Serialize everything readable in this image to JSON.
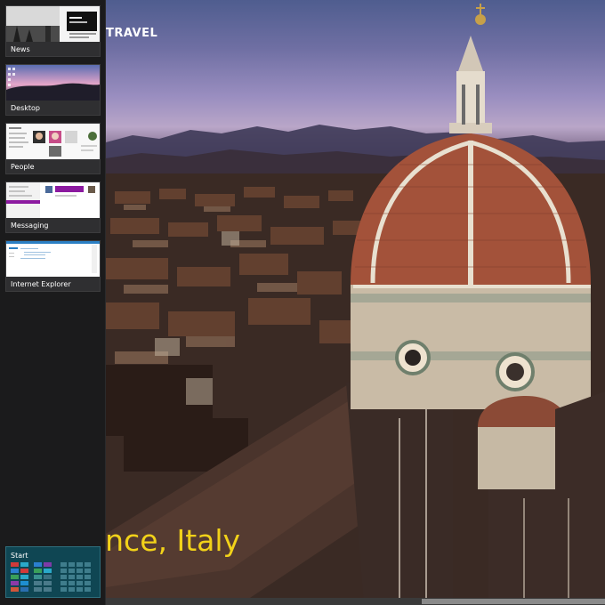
{
  "app": {
    "title": "TRAVEL",
    "location": "rence, Italy"
  },
  "switcher": {
    "tiles": [
      {
        "label": "News"
      },
      {
        "label": "Desktop"
      },
      {
        "label": "People"
      },
      {
        "label": "Messaging"
      },
      {
        "label": "Internet Explorer"
      }
    ],
    "start": {
      "label": "Start"
    }
  },
  "colors": {
    "location_text": "#f2d219",
    "start_tile": "#0f4653",
    "switcher_bg": "#1b1b1c",
    "messaging_accent": "#8c1aa0"
  }
}
